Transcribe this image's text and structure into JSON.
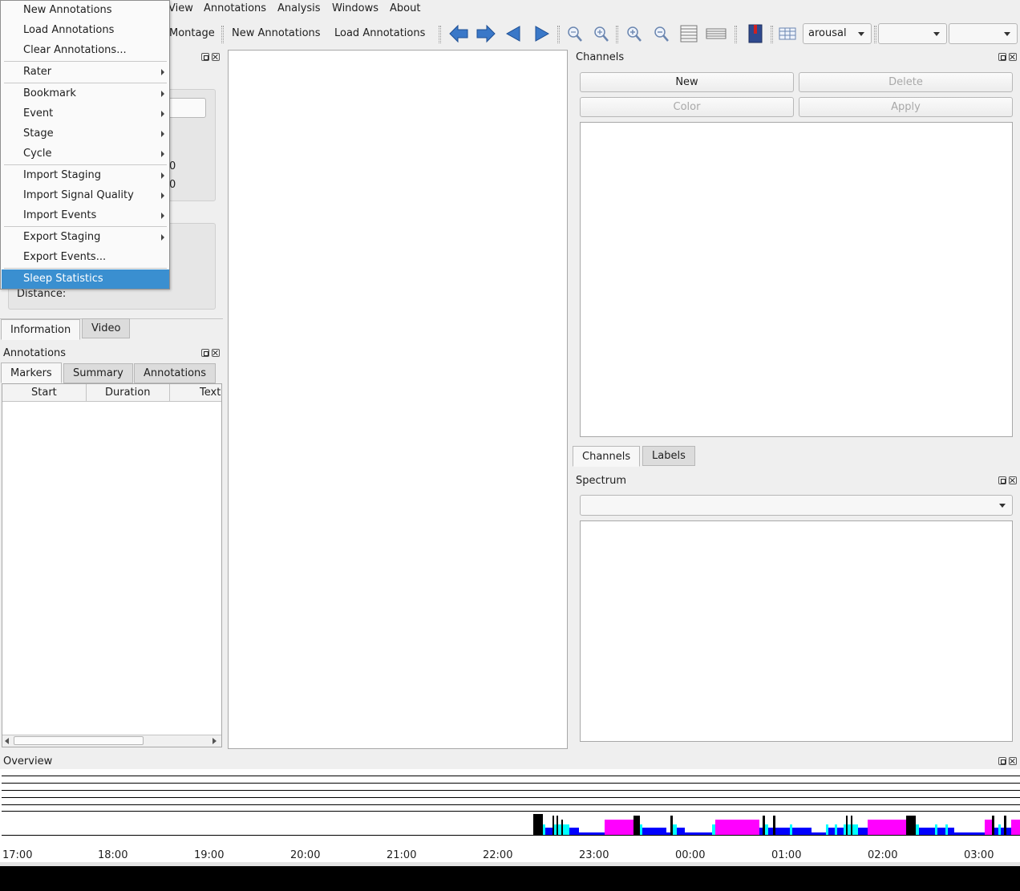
{
  "menubar": {
    "items": [
      "View",
      "Annotations",
      "Analysis",
      "Windows",
      "About"
    ]
  },
  "toolbar": {
    "montage_label": "Montage",
    "new_annotations_label": "New Annotations",
    "load_annotations_label": "Load Annotations",
    "event_type_selected": "arousal",
    "combo2_value": "",
    "combo3_value": ""
  },
  "dropdown": {
    "items": [
      {
        "label": "New Annotations",
        "submenu": false
      },
      {
        "label": "Load Annotations",
        "submenu": false
      },
      {
        "label": "Clear Annotations...",
        "submenu": false
      },
      {
        "label": "Rater",
        "submenu": true
      },
      {
        "label": "Bookmark",
        "submenu": true
      },
      {
        "label": "Event",
        "submenu": true
      },
      {
        "label": "Stage",
        "submenu": true
      },
      {
        "label": "Cycle",
        "submenu": true
      },
      {
        "label": "Import Staging",
        "submenu": true
      },
      {
        "label": "Import Signal Quality",
        "submenu": true
      },
      {
        "label": "Import Events",
        "submenu": true
      },
      {
        "label": "Export Staging",
        "submenu": true
      },
      {
        "label": "Export Events...",
        "submenu": false
      },
      {
        "label": "Sleep Statistics",
        "submenu": false,
        "highlighted": true
      }
    ]
  },
  "info_panel": {
    "distance_label": "Distance:",
    "partial_text_1": "0",
    "partial_text_2": "0",
    "tabs": [
      "Information",
      "Video"
    ],
    "active_tab": "Information"
  },
  "annotations_panel": {
    "title": "Annotations",
    "tabs": [
      "Markers",
      "Summary",
      "Annotations"
    ],
    "active_tab": "Markers",
    "columns": [
      "Start",
      "Duration",
      "Text"
    ],
    "rows": []
  },
  "channels_panel": {
    "title": "Channels",
    "new_label": "New",
    "delete_label": "Delete",
    "color_label": "Color",
    "apply_label": "Apply",
    "tabs": [
      "Channels",
      "Labels"
    ],
    "active_tab": "Channels"
  },
  "spectrum_panel": {
    "title": "Spectrum",
    "channel_selected": ""
  },
  "overview": {
    "title": "Overview",
    "time_ticks": [
      "17:00",
      "18:00",
      "19:00",
      "20:00",
      "21:00",
      "22:00",
      "23:00",
      "00:00",
      "01:00",
      "02:00",
      "03:00"
    ],
    "colors": {
      "wake": "#000000",
      "n1": "#00ffff",
      "n2": "#0000ff",
      "rem": "#ff00ff"
    }
  },
  "colors": {
    "highlight": "#3a8fd0",
    "background": "#efefef"
  }
}
